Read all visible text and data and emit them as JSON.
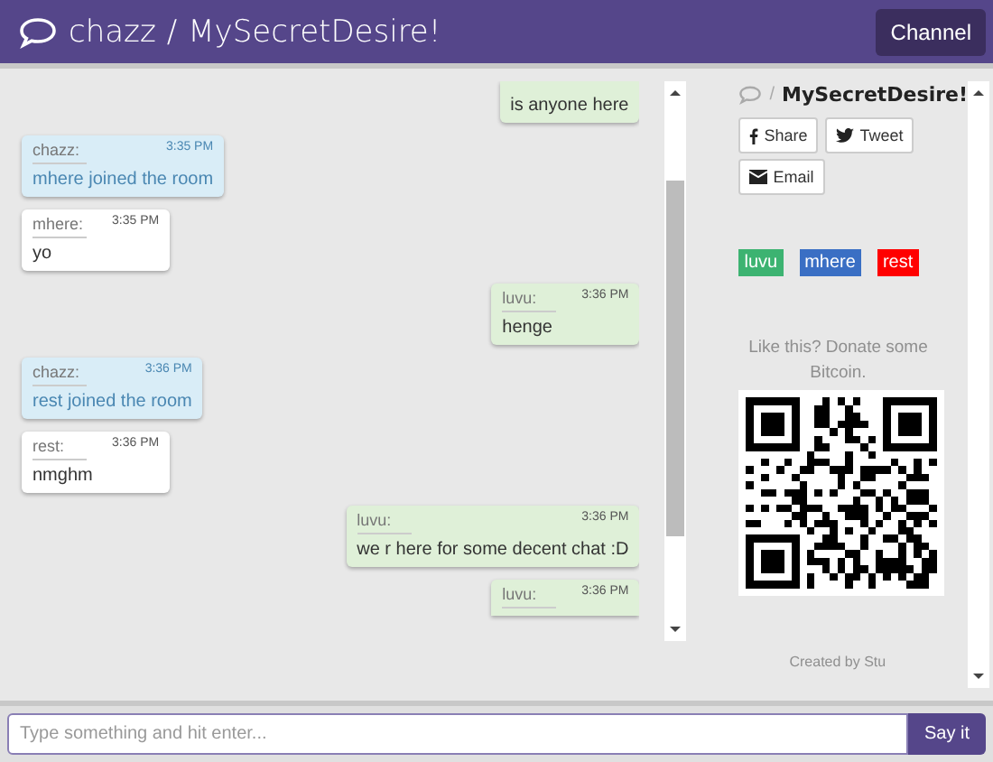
{
  "header": {
    "user": "chazz",
    "separator": "/",
    "room": "MySecretDesire!",
    "channel_button": "Channel"
  },
  "messages": [
    {
      "kind": "self",
      "body": "is anyone here"
    },
    {
      "kind": "system",
      "author": "chazz:",
      "time": "3:35 PM",
      "body": "mhere joined the room"
    },
    {
      "kind": "other",
      "author": "mhere:",
      "time": "3:35 PM",
      "body": "yo"
    },
    {
      "kind": "self",
      "author": "luvu:",
      "time": "3:36 PM",
      "body": "henge"
    },
    {
      "kind": "system",
      "author": "chazz:",
      "time": "3:36 PM",
      "body": "rest joined the room"
    },
    {
      "kind": "other",
      "author": "rest:",
      "time": "3:36 PM",
      "body": "nmghm"
    },
    {
      "kind": "self",
      "author": "luvu:",
      "time": "3:36 PM",
      "body": "we r here for some decent chat :D"
    },
    {
      "kind": "self",
      "author": "luvu:",
      "time": "3:36 PM"
    }
  ],
  "sidebar": {
    "separator": "/",
    "room": "MySecretDesire!",
    "share_buttons": [
      {
        "kind": "facebook",
        "label": "Share"
      },
      {
        "kind": "twitter",
        "label": "Tweet"
      },
      {
        "kind": "email",
        "label": "Email"
      }
    ],
    "users": [
      {
        "name": "luvu",
        "color": "#3cb371"
      },
      {
        "name": "mhere",
        "color": "#3a6fc4"
      },
      {
        "name": "rest",
        "color": "#ff0000"
      }
    ],
    "donate": "Like this? Donate some Bitcoin.",
    "credit": "Created by Stu"
  },
  "composer": {
    "placeholder": "Type something and hit enter...",
    "send_button": "Say it"
  }
}
